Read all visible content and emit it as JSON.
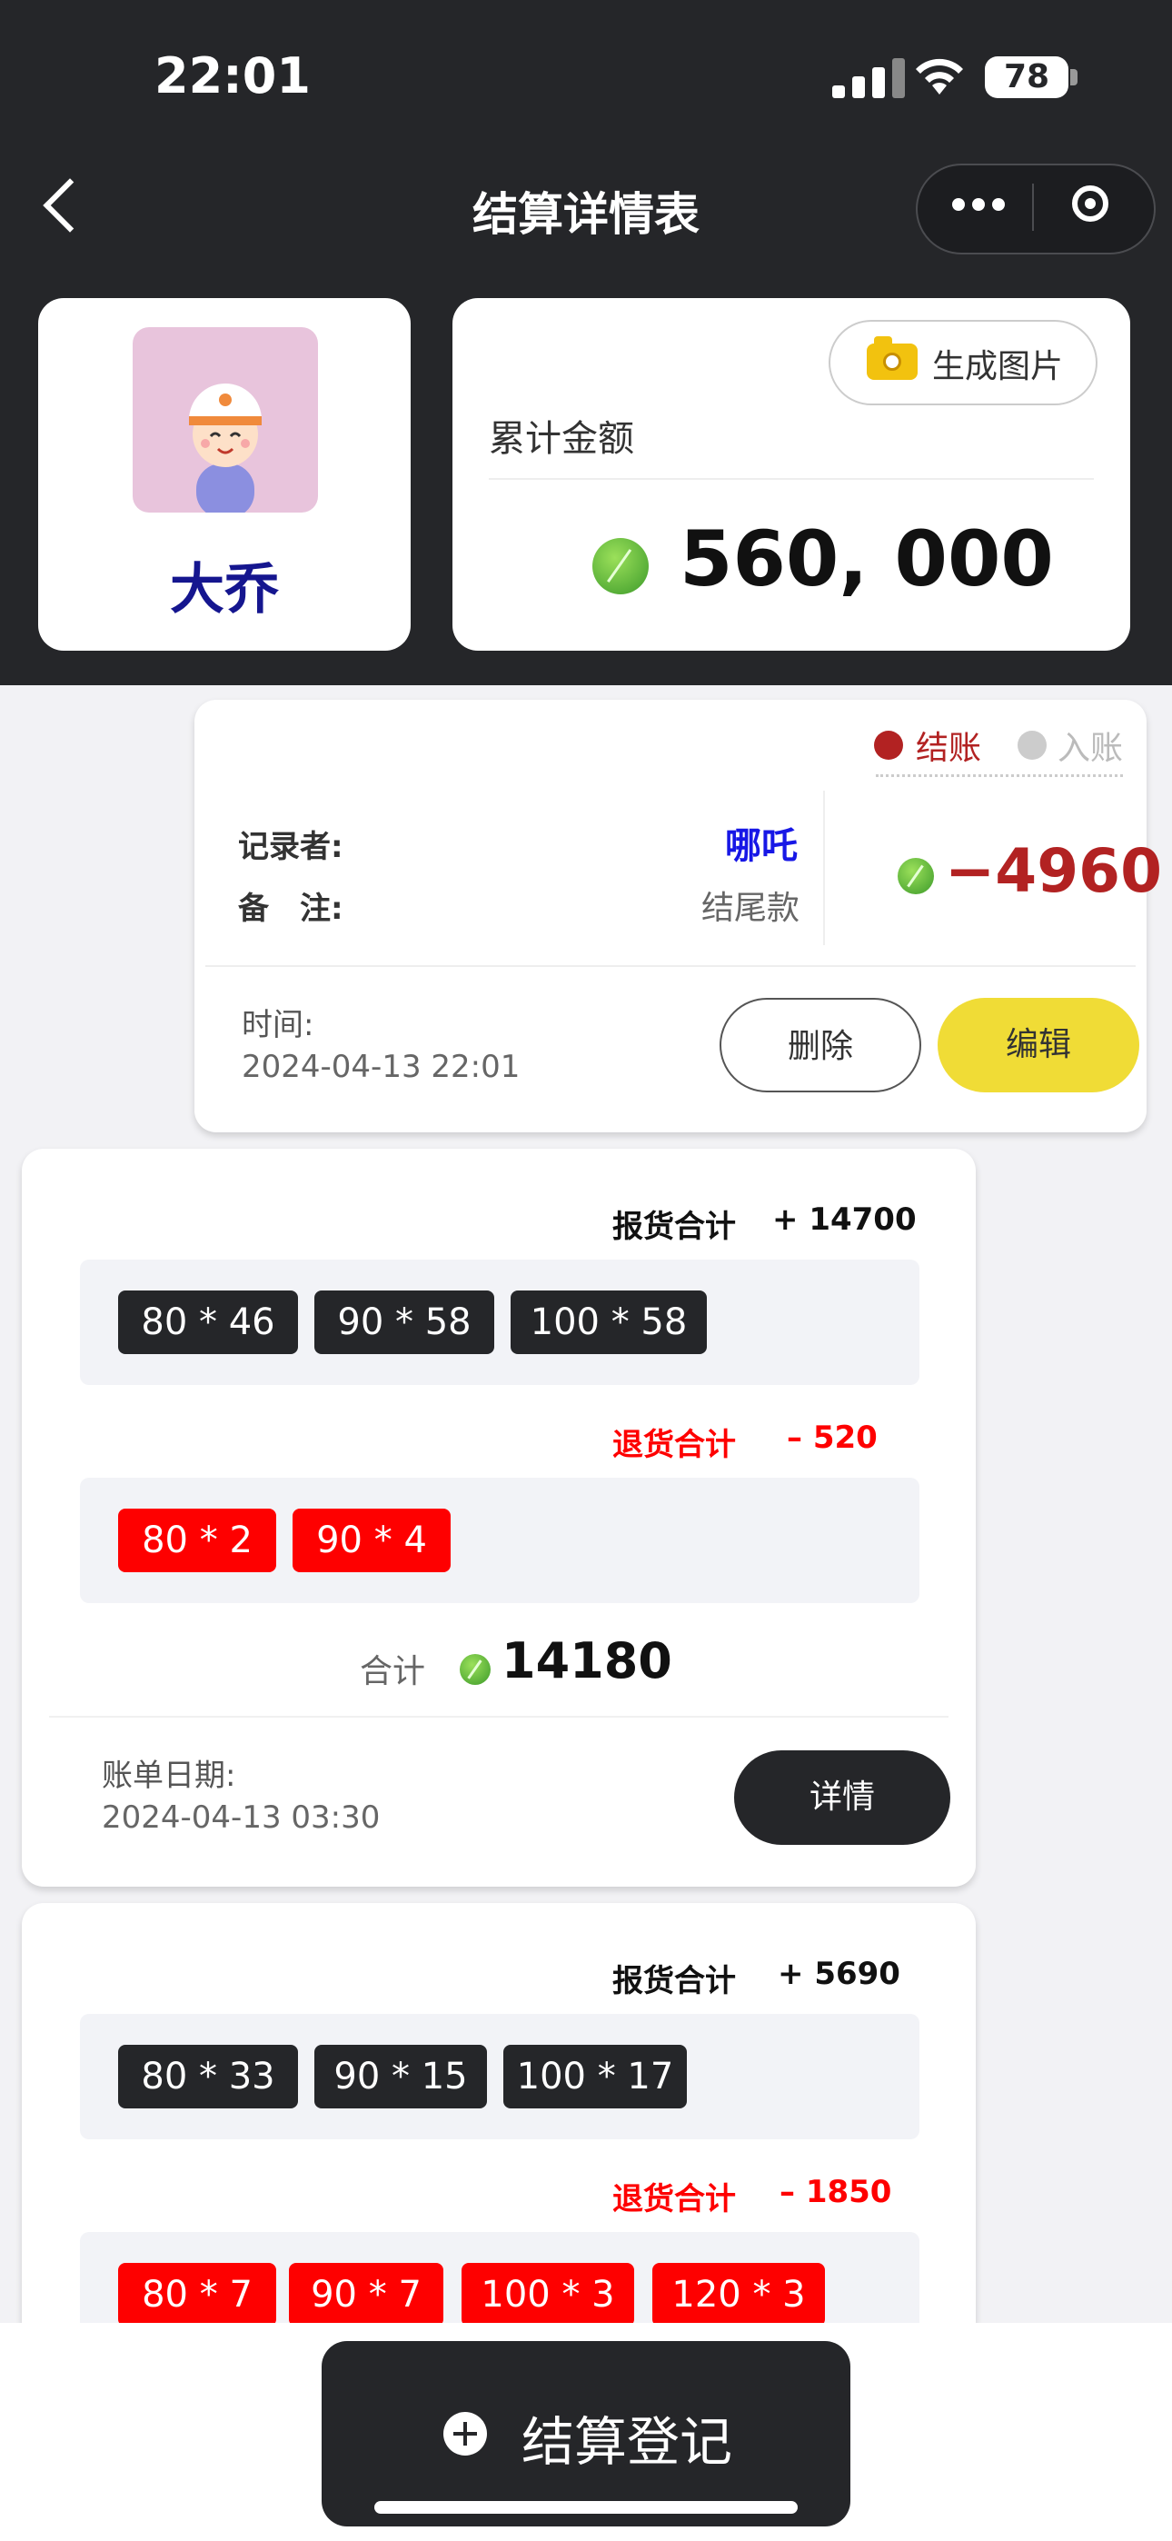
{
  "status_bar": {
    "time": "22:01",
    "battery": "78"
  },
  "nav": {
    "title": "结算详情表"
  },
  "user": {
    "name": "大乔"
  },
  "summary": {
    "generate_image_label": "生成图片",
    "total_label": "累计金额",
    "total_amount": "560, 000"
  },
  "record": {
    "checkout_label": "结账",
    "deposit_label": "入账",
    "recorder_label": "记录者:",
    "recorder_value": "哪吒",
    "note_label": "备　注:",
    "note_value": "结尾款",
    "amount": "−4960",
    "time_label": "时间:",
    "time_value": "2024-04-13 22:01",
    "delete_label": "删除",
    "edit_label": "编辑"
  },
  "bills": [
    {
      "report_label": "报货合计",
      "report_total": "+ 14700",
      "report_tags": [
        "80 * 46",
        "90 * 58",
        "100 * 58"
      ],
      "return_label": "退货合计",
      "return_total": "– 520",
      "return_tags": [
        "80 * 2",
        "90 * 4"
      ],
      "sum_label": "合计",
      "sum_value": "14180",
      "date_label": "账单日期:",
      "date_value": "2024-04-13 03:30",
      "detail_label": "详情"
    },
    {
      "report_label": "报货合计",
      "report_total": "+ 5690",
      "report_tags": [
        "80 * 33",
        "90 * 15",
        "100 * 17"
      ],
      "return_label": "退货合计",
      "return_total": "– 1850",
      "return_tags": [
        "80 * 7",
        "90 * 7",
        "100 * 3",
        "120 * 3"
      ]
    }
  ],
  "bottom": {
    "register_label": "结算登记"
  },
  "colors": {
    "dark": "#252629",
    "accent_yellow": "#f0dc36",
    "danger_red": "#fe0000",
    "amount_red": "#b22222",
    "name_blue": "#15168f",
    "recorder_blue": "#1717e6"
  }
}
